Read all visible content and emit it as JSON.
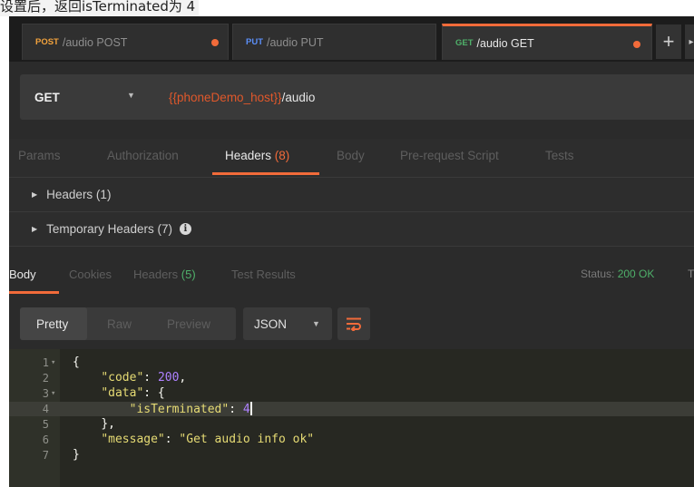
{
  "caption": {
    "text": "设置后，返回isTerminated为 4"
  },
  "tabs": [
    {
      "method": "POST",
      "method_color": "#f2a23c",
      "name": "/audio POST",
      "unsaved": true
    },
    {
      "method": "PUT",
      "method_color": "#5b8ff9",
      "name": "/audio PUT",
      "unsaved": false
    },
    {
      "method": "GET",
      "method_color": "#4fb06a",
      "name": "/audio GET",
      "unsaved": true,
      "active": true
    }
  ],
  "tab_controls": {
    "plus": "+",
    "overflow": "▸"
  },
  "request": {
    "method": "GET",
    "url_variable": "{{phoneDemo_host}}",
    "url_path": "/audio"
  },
  "request_tabs": [
    {
      "label": "Params"
    },
    {
      "label": "Authorization"
    },
    {
      "label": "Headers",
      "count": "(8)",
      "active": true
    },
    {
      "label": "Body"
    },
    {
      "label": "Pre-request Script"
    },
    {
      "label": "Tests"
    }
  ],
  "header_sections": [
    {
      "label": "Headers (1)"
    },
    {
      "label": "Temporary Headers (7)"
    }
  ],
  "response_tabs": [
    {
      "label": "Body",
      "active": true
    },
    {
      "label": "Cookies"
    },
    {
      "label": "Headers",
      "count": "(5)"
    },
    {
      "label": "Test Results"
    }
  ],
  "status": {
    "label": "Status:",
    "value": "200 OK",
    "extra": "T"
  },
  "view_modes": [
    {
      "label": "Pretty",
      "active": true
    },
    {
      "label": "Raw"
    },
    {
      "label": "Preview"
    }
  ],
  "format": {
    "selected": "JSON"
  },
  "code_lines": [
    {
      "num": "1",
      "fold": true,
      "indent": "",
      "parts": [
        {
          "t": "{",
          "c": "p"
        }
      ]
    },
    {
      "num": "2",
      "fold": false,
      "indent": "    ",
      "parts": [
        {
          "t": "\"code\"",
          "c": "k"
        },
        {
          "t": ": ",
          "c": "p"
        },
        {
          "t": "200",
          "c": "n"
        },
        {
          "t": ",",
          "c": "p"
        }
      ]
    },
    {
      "num": "3",
      "fold": true,
      "indent": "    ",
      "parts": [
        {
          "t": "\"data\"",
          "c": "k"
        },
        {
          "t": ": {",
          "c": "p"
        }
      ]
    },
    {
      "num": "4",
      "fold": false,
      "indent": "        ",
      "highlight": true,
      "parts": [
        {
          "t": "\"isTerminated\"",
          "c": "k"
        },
        {
          "t": ": ",
          "c": "p"
        },
        {
          "t": "4",
          "c": "n"
        }
      ]
    },
    {
      "num": "5",
      "fold": false,
      "indent": "    ",
      "parts": [
        {
          "t": "},",
          "c": "p"
        }
      ]
    },
    {
      "num": "6",
      "fold": false,
      "indent": "    ",
      "parts": [
        {
          "t": "\"message\"",
          "c": "k"
        },
        {
          "t": ": ",
          "c": "p"
        },
        {
          "t": "\"Get audio info ok\"",
          "c": "s"
        }
      ]
    },
    {
      "num": "7",
      "fold": false,
      "indent": "",
      "parts": [
        {
          "t": "}",
          "c": "p"
        }
      ]
    }
  ]
}
